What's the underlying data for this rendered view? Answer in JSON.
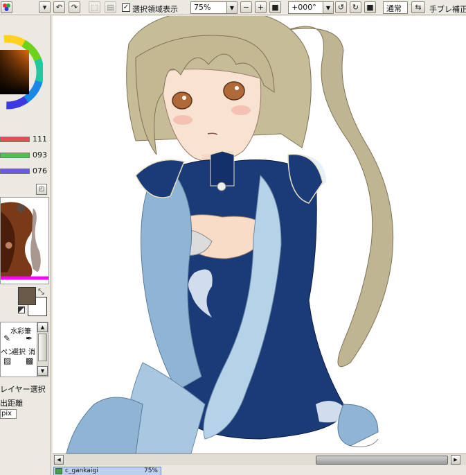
{
  "toolbar": {
    "show_selection_label": "選択領域表示",
    "zoom_value": "75%",
    "rotate_value": "+000°",
    "blend_mode": "通常",
    "stabilizer_label": "手ブレ補正"
  },
  "color_panel": {
    "rgb": [
      {
        "channel": "red",
        "value": "111",
        "color": "#e05050"
      },
      {
        "channel": "green",
        "value": "093",
        "color": "#50c050"
      },
      {
        "channel": "blue",
        "value": "076",
        "color": "#6a5ae0"
      }
    ],
    "foreground_color": "#6a5a4a",
    "background_color": "#ffffff"
  },
  "tools": {
    "watercolor_label": "水彩筆",
    "pen_label": "ペン",
    "select_label": "選択",
    "eraser_label": "消し"
  },
  "layer_panel": {
    "layer_select_label": "レイヤー選択",
    "distance_label": "出距離",
    "unit_label": "pix"
  },
  "canvas": {
    "document_tab_label": "c_gankaigi",
    "document_tab_zoom": "75%"
  }
}
